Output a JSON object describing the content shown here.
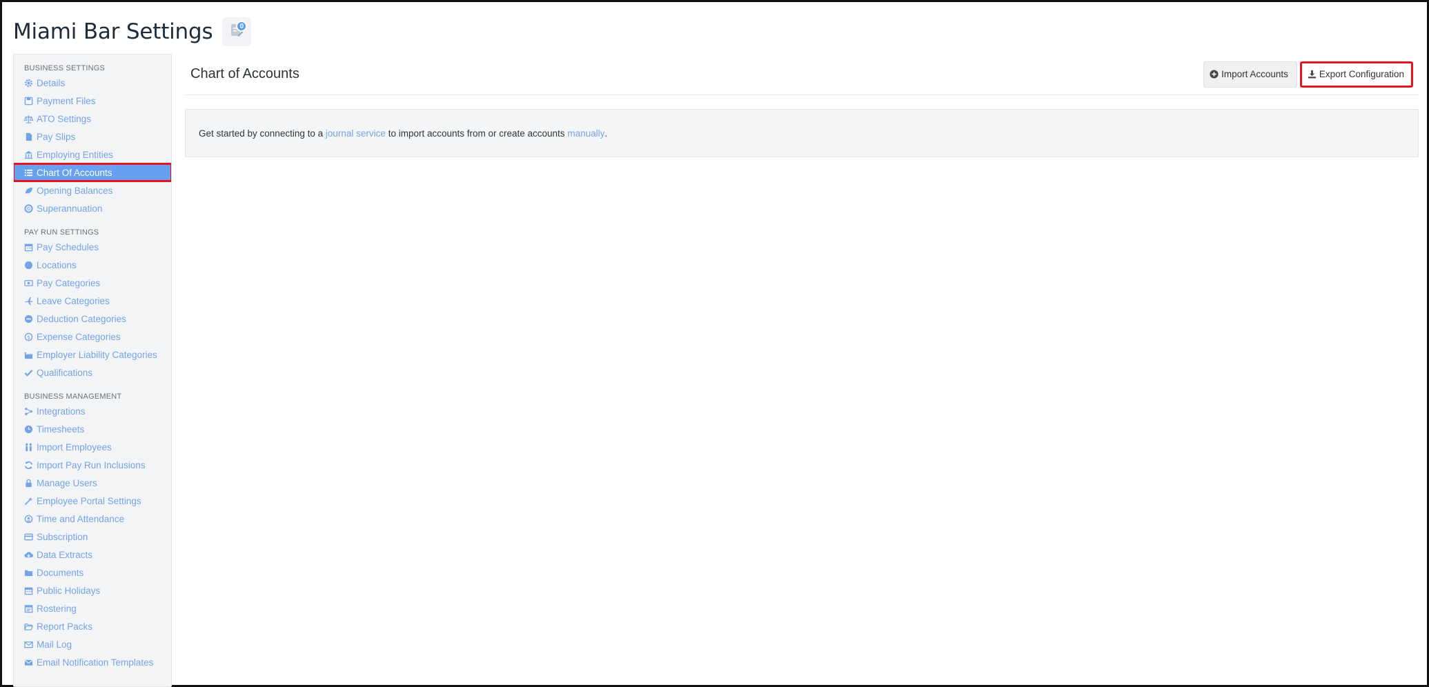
{
  "header": {
    "title": "Miami Bar Settings",
    "notification_count": "0"
  },
  "sidebar": {
    "sections": [
      {
        "heading": "BUSINESS SETTINGS",
        "items": [
          {
            "label": "Details",
            "icon": "gear-icon"
          },
          {
            "label": "Payment Files",
            "icon": "save-icon"
          },
          {
            "label": "ATO Settings",
            "icon": "scale-icon"
          },
          {
            "label": "Pay Slips",
            "icon": "file-icon"
          },
          {
            "label": "Employing Entities",
            "icon": "bank-icon"
          },
          {
            "label": "Chart Of Accounts",
            "icon": "list-icon",
            "active": true
          },
          {
            "label": "Opening Balances",
            "icon": "leaf-icon"
          },
          {
            "label": "Superannuation",
            "icon": "lifebuoy-icon"
          }
        ]
      },
      {
        "heading": "PAY RUN SETTINGS",
        "items": [
          {
            "label": "Pay Schedules",
            "icon": "calendar-icon"
          },
          {
            "label": "Locations",
            "icon": "globe-icon"
          },
          {
            "label": "Pay Categories",
            "icon": "money-icon"
          },
          {
            "label": "Leave Categories",
            "icon": "plane-icon"
          },
          {
            "label": "Deduction Categories",
            "icon": "minus-circle-icon"
          },
          {
            "label": "Expense Categories",
            "icon": "dollar-cycle-icon"
          },
          {
            "label": "Employer Liability Categories",
            "icon": "factory-icon"
          },
          {
            "label": "Qualifications",
            "icon": "check-icon"
          }
        ]
      },
      {
        "heading": "BUSINESS MANAGEMENT",
        "items": [
          {
            "label": "Integrations",
            "icon": "integration-icon"
          },
          {
            "label": "Timesheets",
            "icon": "clock-icon"
          },
          {
            "label": "Import Employees",
            "icon": "users-icon"
          },
          {
            "label": "Import Pay Run Inclusions",
            "icon": "refresh-icon"
          },
          {
            "label": "Manage Users",
            "icon": "lock-icon"
          },
          {
            "label": "Employee Portal Settings",
            "icon": "magic-icon"
          },
          {
            "label": "Time and Attendance",
            "icon": "time-attendance-icon"
          },
          {
            "label": "Subscription",
            "icon": "credit-card-icon"
          },
          {
            "label": "Data Extracts",
            "icon": "cloud-download-icon"
          },
          {
            "label": "Documents",
            "icon": "folder-icon"
          },
          {
            "label": "Public Holidays",
            "icon": "calendar-icon"
          },
          {
            "label": "Rostering",
            "icon": "roster-icon"
          },
          {
            "label": "Report Packs",
            "icon": "folder-open-icon"
          },
          {
            "label": "Mail Log",
            "icon": "envelope-icon"
          },
          {
            "label": "Email Notification Templates",
            "icon": "envelope-filled-icon"
          }
        ]
      }
    ]
  },
  "main": {
    "title": "Chart of Accounts",
    "import_button": "Import Accounts",
    "export_button": "Export Configuration",
    "info": {
      "prefix": "Get started by connecting to a ",
      "link1": "journal service",
      "middle": " to import accounts from or create accounts ",
      "link2": "manually",
      "suffix": "."
    }
  },
  "colors": {
    "link": "#74a3e6",
    "active_bg": "#66a0f1",
    "highlight_border": "#e8141c"
  }
}
